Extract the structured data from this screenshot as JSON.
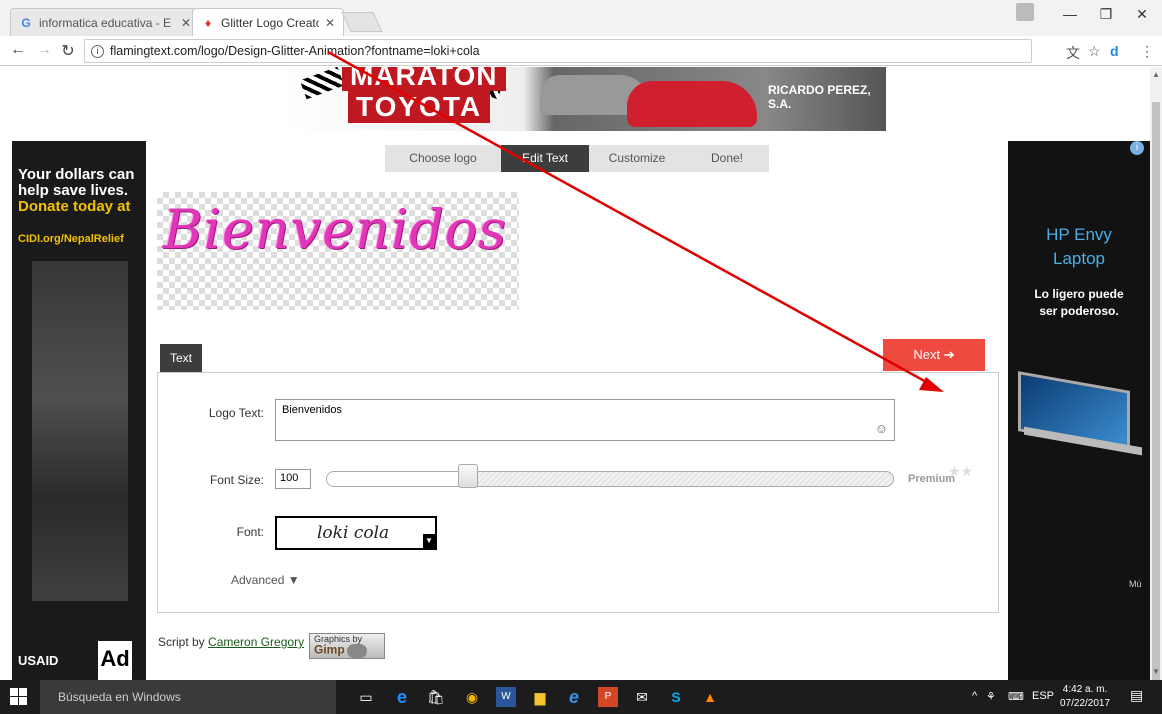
{
  "browser": {
    "tabs": [
      {
        "title": "informatica educativa - E",
        "favicon": "G",
        "favicon_color": "#4285f4",
        "active": false
      },
      {
        "title": "Glitter Logo Creator | Fre",
        "favicon": "flame-icon",
        "favicon_color": "#e5342c",
        "active": true
      }
    ],
    "url": "flamingtext.com/logo/Design-Glitter-Animation?fontname=loki+cola"
  },
  "banner": {
    "line1": "MARATON",
    "line2": "TOYOTA",
    "dealer": "RICARDO PEREZ, S.A."
  },
  "steps": [
    "Choose logo",
    "Edit Text",
    "Customize",
    "Done!"
  ],
  "active_step": 1,
  "preview": {
    "logo_text": "Bienvenidos",
    "logo_color": "#e236b8"
  },
  "form": {
    "tab_label": "Text",
    "next_label": "Next ➔",
    "logo_text_label": "Logo Text:",
    "logo_text_value": "Bienvenidos",
    "font_size_label": "Font Size:",
    "font_size_value": "100",
    "font_size_slider_fraction": 0.25,
    "premium_label": "Premium",
    "font_label": "Font:",
    "font_value": "loki cola",
    "advanced_label": "Advanced ▼"
  },
  "footer": {
    "script_by": "Script by",
    "author": "Cameron Gregory",
    "gimp_small": "Graphics by",
    "gimp_label": "Gimp"
  },
  "left_ad": {
    "line1": "Your dollars can help save lives.",
    "line2": "Donate today at",
    "line3": "CIDI.org/NepalRelief",
    "brand": "USAID",
    "ad_box": "Ad"
  },
  "right_ad": {
    "title1": "HP Envy",
    "title2": "Laptop",
    "tagline": "Lo ligero puede ser poderoso.",
    "more": "Mú"
  },
  "taskbar": {
    "search_placeholder": "Búsqueda en Windows",
    "language": "ESP",
    "time": "4:42 a. m.",
    "date": "07/22/2017"
  },
  "colors": {
    "accent": "#f0493f",
    "step_active": "#3d3d3d",
    "annotation_arrow": "#e00000"
  }
}
